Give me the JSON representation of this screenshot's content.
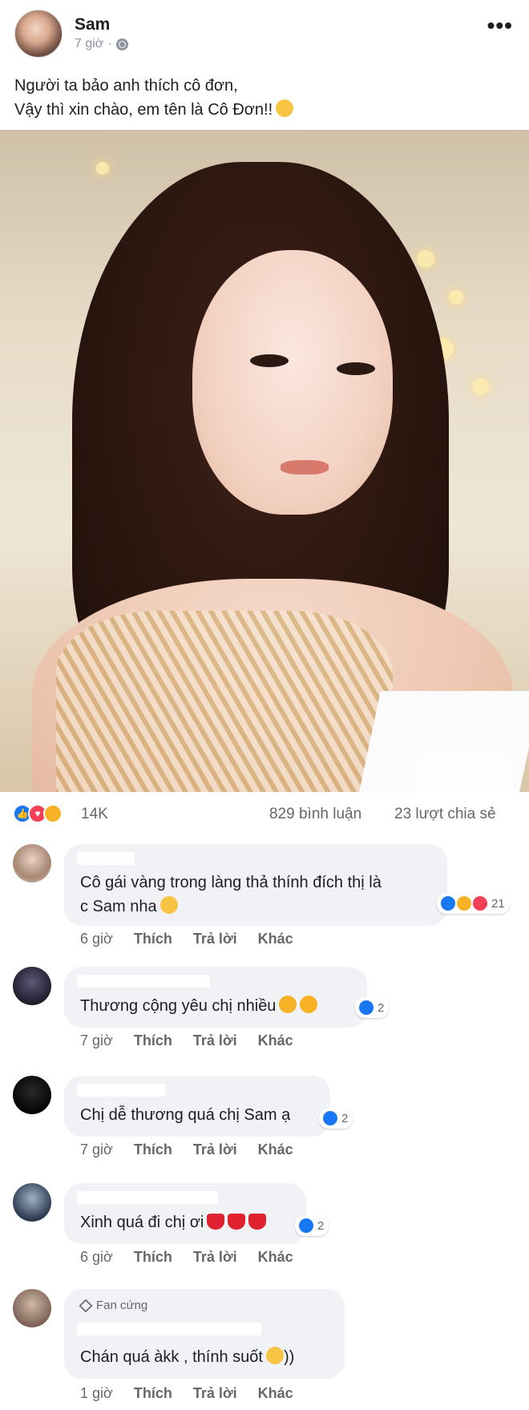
{
  "post": {
    "author": "Sam",
    "time": "7 giờ",
    "separator": "·",
    "privacy_icon": "globe-icon",
    "more_label": "•••",
    "caption_line1": "Người ta bảo anh thích cô đơn,",
    "caption_line2": "Vậy thì xin chào, em tên là Cô Đơn!!",
    "caption_emoji": "squinting-tongue-emoji",
    "photo_alt": "photo"
  },
  "reactions": {
    "icons": [
      "like-icon",
      "love-icon",
      "haha-icon"
    ],
    "count": "14K",
    "comments": "829 bình luận",
    "shares": "23 lượt chia sẻ"
  },
  "actions": {
    "like": "Thích",
    "reply": "Trả lời",
    "more": "Khác"
  },
  "comments": [
    {
      "line1": "Cô gái vàng trong làng thả thính đích thị là",
      "line2": "c Sam nha",
      "time": "6 giờ",
      "reaction_count": "21",
      "reaction_icons": [
        "like-icon",
        "haha-icon",
        "love-icon"
      ]
    },
    {
      "line1": "Thương cộng yêu chị nhiều",
      "time": "7 giờ",
      "reaction_count": "2",
      "reaction_icons": [
        "like-icon"
      ]
    },
    {
      "line1": "Chị dễ thương quá chị Sam ạ",
      "time": "7 giờ",
      "reaction_count": "2",
      "reaction_icons": [
        "like-icon"
      ]
    },
    {
      "line1": "Xinh quá đi chị ơi",
      "time": "6 giờ",
      "reaction_count": "2",
      "reaction_icons": [
        "like-icon"
      ]
    },
    {
      "badge": "Fan cứng",
      "line1": "Chán quá àkk , thính suốt",
      "line1_tail": "))",
      "time": "1 giờ"
    }
  ],
  "colors": {
    "like_blue": "#1877f2",
    "love_red": "#f33e58",
    "haha_yellow": "#f7b125",
    "bubble_bg": "#f0f2f5",
    "meta_gray": "#65676b"
  }
}
